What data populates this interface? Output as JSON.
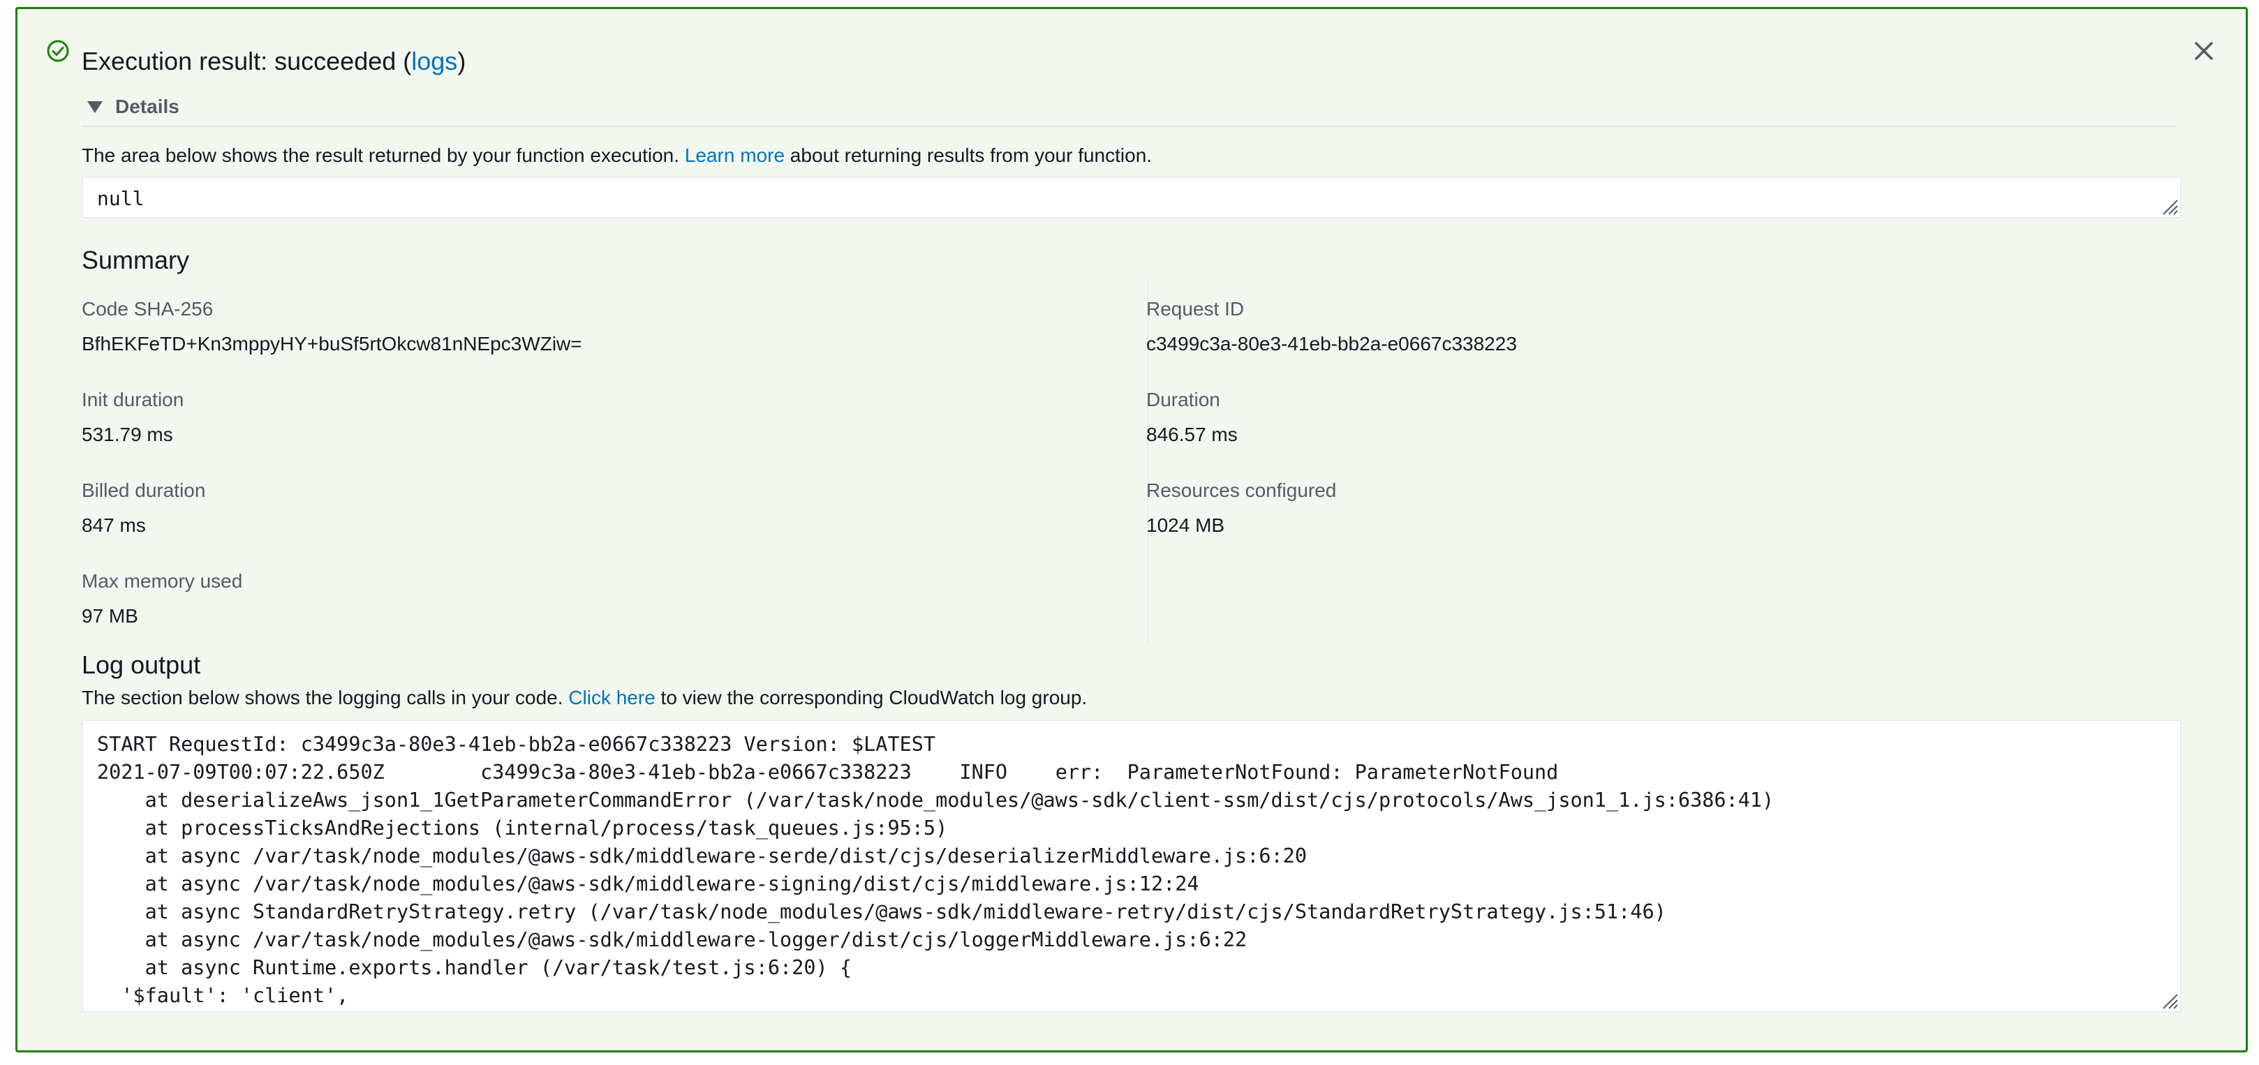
{
  "result": {
    "title_prefix": "Execution result: succeeded (",
    "logs_link": "logs",
    "title_suffix": ")",
    "status_icon": "check-circle-icon",
    "close_icon": "close-icon",
    "colors": {
      "success_border": "#1d8102",
      "panel_bg": "#f2f8f0",
      "link": "#0073bb"
    }
  },
  "details": {
    "toggle_label": "Details",
    "desc_before": "The area below shows the result returned by your function execution. ",
    "desc_link": "Learn more",
    "desc_after": " about returning results from your function.",
    "result_value": "null"
  },
  "summary": {
    "heading": "Summary",
    "left": [
      {
        "label": "Code SHA-256",
        "value": "BfhEKFeTD+Kn3mppyHY+buSf5rtOkcw81nNEpc3WZiw="
      },
      {
        "label": "Init duration",
        "value": "531.79 ms"
      },
      {
        "label": "Billed duration",
        "value": "847 ms"
      },
      {
        "label": "Max memory used",
        "value": "97 MB"
      }
    ],
    "right": [
      {
        "label": "Request ID",
        "value": "c3499c3a-80e3-41eb-bb2a-e0667c338223"
      },
      {
        "label": "Duration",
        "value": "846.57 ms"
      },
      {
        "label": "Resources configured",
        "value": "1024 MB"
      }
    ]
  },
  "log": {
    "heading": "Log output",
    "desc_before": "The section below shows the logging calls in your code. ",
    "desc_link": "Click here",
    "desc_after": " to view the corresponding CloudWatch log group.",
    "lines": [
      "START RequestId: c3499c3a-80e3-41eb-bb2a-e0667c338223 Version: $LATEST",
      "2021-07-09T00:07:22.650Z\tc3499c3a-80e3-41eb-bb2a-e0667c338223\tINFO\terr:  ParameterNotFound: ParameterNotFound",
      "    at deserializeAws_json1_1GetParameterCommandError (/var/task/node_modules/@aws-sdk/client-ssm/dist/cjs/protocols/Aws_json1_1.js:6386:41)",
      "    at processTicksAndRejections (internal/process/task_queues.js:95:5)",
      "    at async /var/task/node_modules/@aws-sdk/middleware-serde/dist/cjs/deserializerMiddleware.js:6:20",
      "    at async /var/task/node_modules/@aws-sdk/middleware-signing/dist/cjs/middleware.js:12:24",
      "    at async StandardRetryStrategy.retry (/var/task/node_modules/@aws-sdk/middleware-retry/dist/cjs/StandardRetryStrategy.js:51:46)",
      "    at async /var/task/node_modules/@aws-sdk/middleware-logger/dist/cjs/loggerMiddleware.js:6:22",
      "    at async Runtime.exports.handler (/var/task/test.js:6:20) {",
      "  '$fault': 'client',"
    ]
  }
}
